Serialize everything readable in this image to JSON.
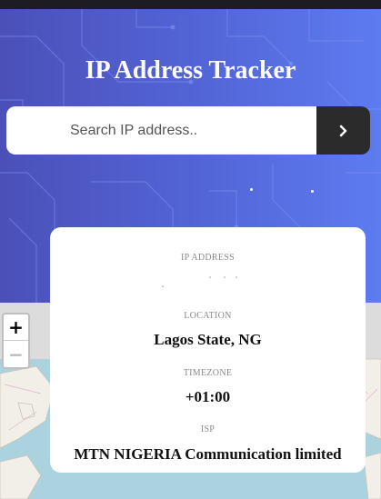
{
  "header": {
    "title": "IP Address Tracker"
  },
  "search": {
    "placeholder": "Search IP address..",
    "submit_icon": "chevron-right-icon"
  },
  "info": {
    "ip_label": "IP ADDRESS",
    "ip_value": "",
    "location_label": "LOCATION",
    "location_value": "Lagos State, NG",
    "timezone_label": "TIMEZONE",
    "timezone_value": "+01:00",
    "isp_label": "ISP",
    "isp_value": "MTN NIGERIA Communication limited"
  },
  "map": {
    "zoom_in_label": "+",
    "zoom_out_label": "−"
  },
  "colors": {
    "hero_gradient_start": "#4b50b8",
    "hero_gradient_end": "#5d7cf0",
    "button": "#2b2b2b",
    "card": "#ffffff",
    "water": "#aad3df",
    "land": "#f2efe9"
  }
}
